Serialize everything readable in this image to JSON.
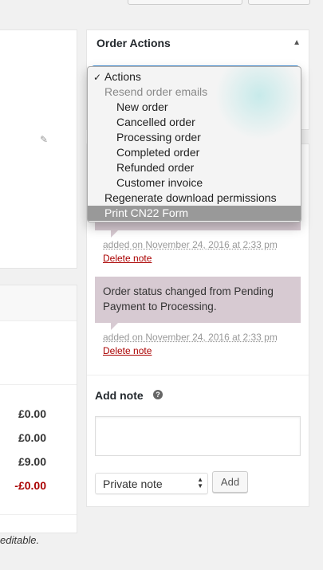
{
  "order_actions": {
    "title": "Order Actions",
    "dropdown": {
      "selected": "Actions",
      "group_label": "Resend order emails",
      "email_items": [
        "New order",
        "Cancelled order",
        "Processing order",
        "Completed order",
        "Refunded order",
        "Customer invoice"
      ],
      "regenerate": "Regenerate download permissions",
      "highlighted": "Print CN22 Form"
    }
  },
  "notes": [
    {
      "meta": "added on November 24, 2016 at 2:33 pm",
      "delete": "Delete note"
    },
    {
      "text": "Order status changed from Pending Payment to Processing.",
      "meta": "added on November 24, 2016 at 2:33 pm",
      "delete": "Delete note"
    }
  ],
  "add_note": {
    "title": "Add note",
    "type_value": "Private note",
    "add_label": "Add"
  },
  "totals": [
    "£0.00",
    "£0.00",
    "£9.00",
    "-£0.00"
  ],
  "footer_fragment": "editable.",
  "colors": {
    "note_bg": "#d7cad2",
    "delete": "#aa0000",
    "highlight": "#999999"
  }
}
